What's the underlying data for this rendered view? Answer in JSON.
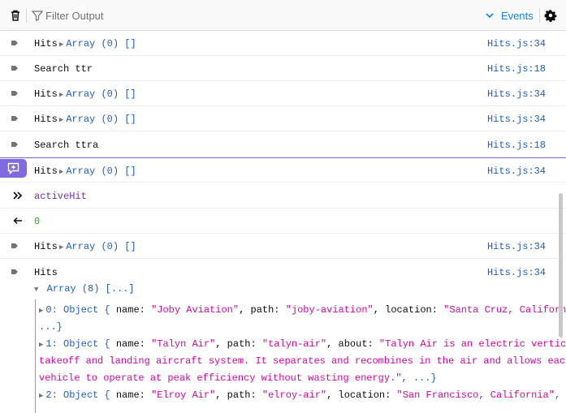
{
  "toolbar": {
    "filter_placeholder": "Filter Output",
    "events_label": "Events"
  },
  "rows": [
    {
      "label": "Hits",
      "array": "Array (0) []",
      "source": "Hits.js:34"
    },
    {
      "label": "Search ttr",
      "source": "Hits.js:18"
    },
    {
      "label": "Hits",
      "array": "Array (0) []",
      "source": "Hits.js:34"
    },
    {
      "label": "Hits",
      "array": "Array (0) []",
      "source": "Hits.js:34"
    },
    {
      "label": "Search ttra",
      "source": "Hits.js:18"
    },
    {
      "label": "Hits",
      "array": "Array (0) []",
      "source": "Hits.js:34"
    },
    {
      "command": "activeHit"
    },
    {
      "result": "0"
    },
    {
      "label": "Hits",
      "array": "Array (0) []",
      "source": "Hits.js:34"
    },
    {
      "label": "Hits",
      "source": "Hits.js:34"
    }
  ],
  "tree": {
    "root": "Array (8) [...]",
    "item0": {
      "prefix": "0: Object { ",
      "k1": "name: ",
      "v1": "\"Joby Aviation\"",
      "k2": ", path: ",
      "v2": "\"joby-aviation\"",
      "k3": ", location: ",
      "v3": "\"Santa Cruz, California\"",
      "tail1": ",",
      "tail2": "...}"
    },
    "item1": {
      "prefix": "1: Object { ",
      "k1": "name: ",
      "v1": "\"Talyn Air\"",
      "k2": ", path: ",
      "v2": "\"talyn-air\"",
      "k3": ", about: ",
      "v3a": "\"Talyn Air is an electric vertical",
      "v3b": "takeoff and landing aircraft system. It separates and recombines in the air and allows each",
      "v3c": "vehicle to operate at peak efficiency without wasting energy.\"",
      "tail": ", ...}"
    },
    "item2": {
      "prefix": "2: Object { ",
      "k1": "name: ",
      "v1": "\"Elroy Air\"",
      "k2": ", path: ",
      "v2": "\"elroy-air\"",
      "k3": ", location: ",
      "v3": "\"San Francisco, California\"",
      "tail": ","
    }
  }
}
